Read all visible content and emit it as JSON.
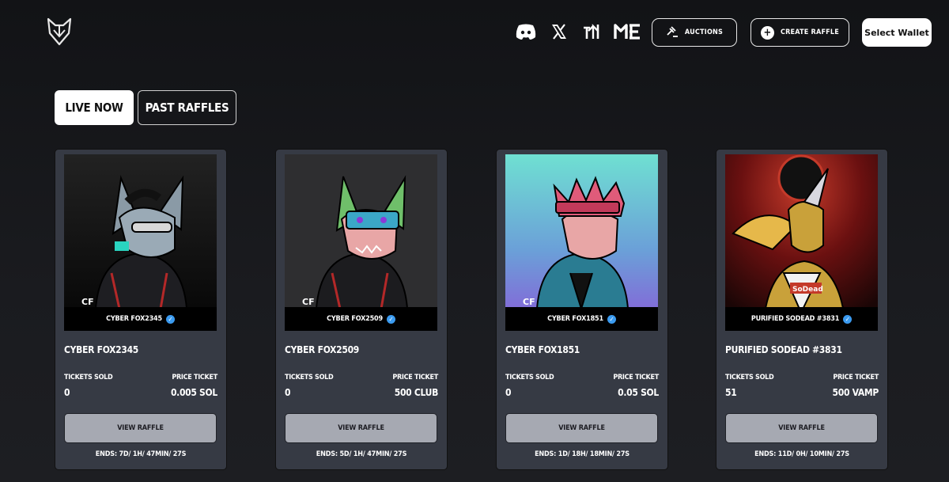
{
  "header": {
    "logo_icon": "fox-logo-icon",
    "socials": [
      "discord-icon",
      "x-icon",
      "tensor-icon",
      "magic-eden-icon",
      "solana-6-icon"
    ],
    "auctions_label": "AUCTIONS",
    "create_raffle_label": "CREATE RAFFLE",
    "wallet_label": "Select Wallet"
  },
  "tabs": {
    "live": "LIVE NOW",
    "past": "PAST RAFFLES"
  },
  "labels": {
    "tickets_sold": "TICKETS SOLD",
    "price_ticket": "PRICE TICKET",
    "view_raffle": "VIEW RAFFLE"
  },
  "cards": [
    {
      "name": "CYBER FOX2345",
      "caption": "CYBER FOX2345",
      "tickets_sold": "0",
      "price": "0.005 SOL",
      "ends": "ENDS: 7D/ 1H/ 47MIN/ 27S",
      "bg": "#1a1a1a"
    },
    {
      "name": "CYBER FOX2509",
      "caption": "CYBER FOX2509",
      "tickets_sold": "0",
      "price": "500 CLUB",
      "ends": "ENDS: 5D/ 1H/ 47MIN/ 27S",
      "bg": "#2e2e30"
    },
    {
      "name": "CYBER FOX1851",
      "caption": "CYBER FOX1851",
      "tickets_sold": "0",
      "price": "0.05 SOL",
      "ends": "ENDS: 1D/ 18H/ 18MIN/ 27S",
      "bg": "#6fd8d0"
    },
    {
      "name": "PURIFIED SODEAD #3831",
      "caption": "PURIFIED SODEAD #3831",
      "tickets_sold": "51",
      "price": "500 VAMP",
      "ends": "ENDS: 11D/ 0H/ 10MIN/ 27S",
      "bg": "#3a0d0d"
    }
  ],
  "art_badges": {
    "cf": "CF",
    "sodead": "SoDead"
  },
  "colors": {
    "bg": "#121316",
    "card": "#363a44",
    "button": "#a6a9b2",
    "verify": "#3b9bf0"
  }
}
